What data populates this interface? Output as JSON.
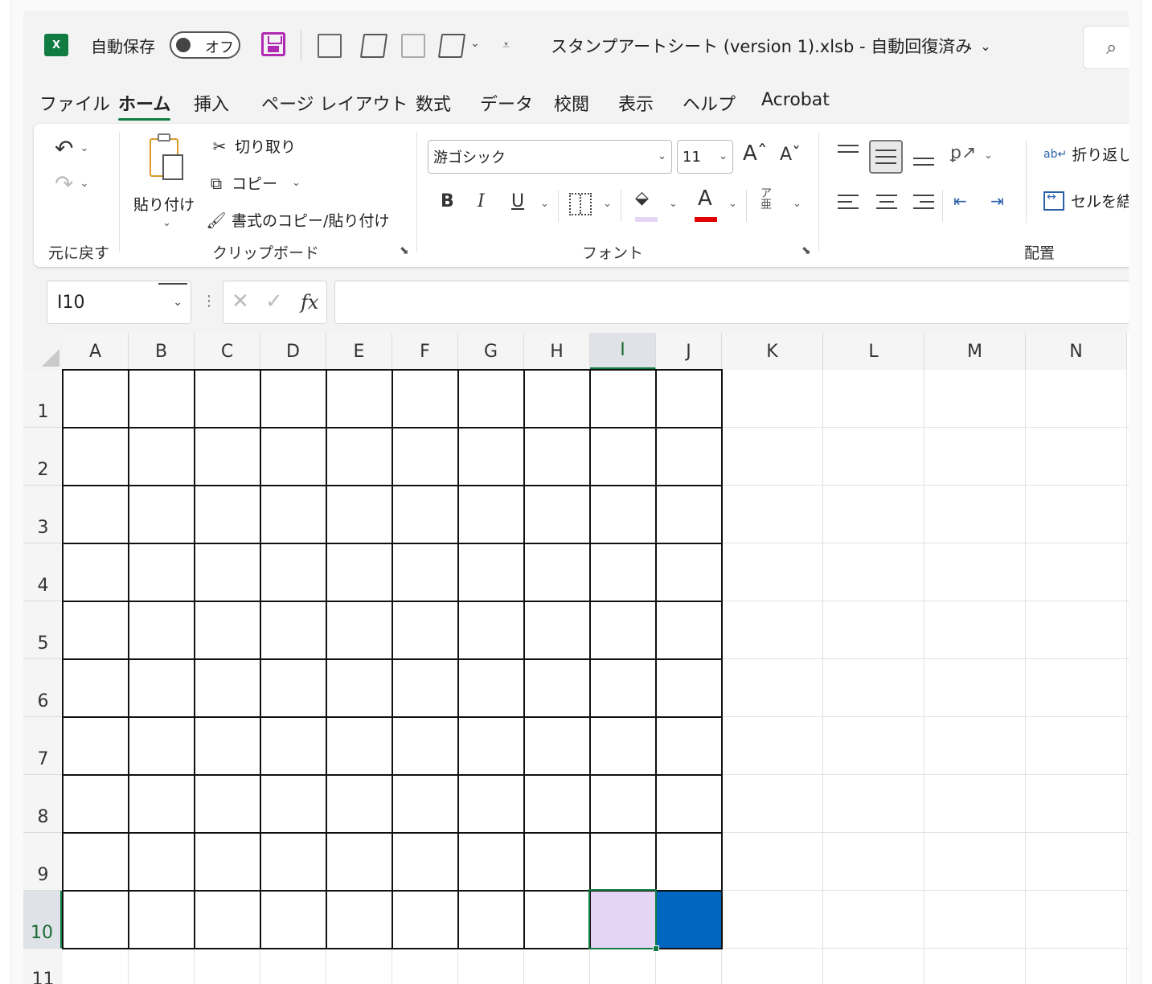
{
  "titlebar": {
    "app_badge": "X",
    "autosave_label": "自動保存",
    "autosave_state": "オフ",
    "document_title": "スタンプアートシート (version 1).xlsb  -  自動回復済み",
    "search_glyph": "⌕"
  },
  "menu": {
    "items": [
      "ファイル",
      "ホーム",
      "挿入",
      "ページ レイアウト",
      "数式",
      "データ",
      "校閲",
      "表示",
      "ヘルプ",
      "Acrobat"
    ],
    "active": "ホーム"
  },
  "ribbon": {
    "undo_group_label": "元に戻す",
    "clipboard": {
      "label": "クリップボード",
      "paste": "貼り付け",
      "cut": "切り取り",
      "copy": "コピー",
      "format_painter": "書式のコピー/貼り付け"
    },
    "font": {
      "label": "フォント",
      "name": "游ゴシック",
      "size": "11",
      "bold": "B",
      "italic": "I",
      "underline": "U",
      "font_color_glyph": "A",
      "fill_color": "#e4d5f5",
      "font_color": "#e00000"
    },
    "alignment": {
      "label": "配置",
      "wrap_text": "折り返し",
      "merge": "セルを結"
    }
  },
  "formula_bar": {
    "name_box": "I10",
    "formula": ""
  },
  "sheet": {
    "columns": [
      "A",
      "B",
      "C",
      "D",
      "E",
      "F",
      "G",
      "H",
      "I",
      "J",
      "K",
      "L",
      "M",
      "N"
    ],
    "rows": [
      "1",
      "2",
      "3",
      "4",
      "5",
      "6",
      "7",
      "8",
      "9",
      "10",
      "11"
    ],
    "selected_column": "I",
    "selected_row": "10",
    "bordered_range": "A1:J10",
    "filled_cells": [
      {
        "cell": "I10",
        "color": "#e4d5f5"
      },
      {
        "cell": "J10",
        "color": "#0066c0"
      }
    ]
  }
}
